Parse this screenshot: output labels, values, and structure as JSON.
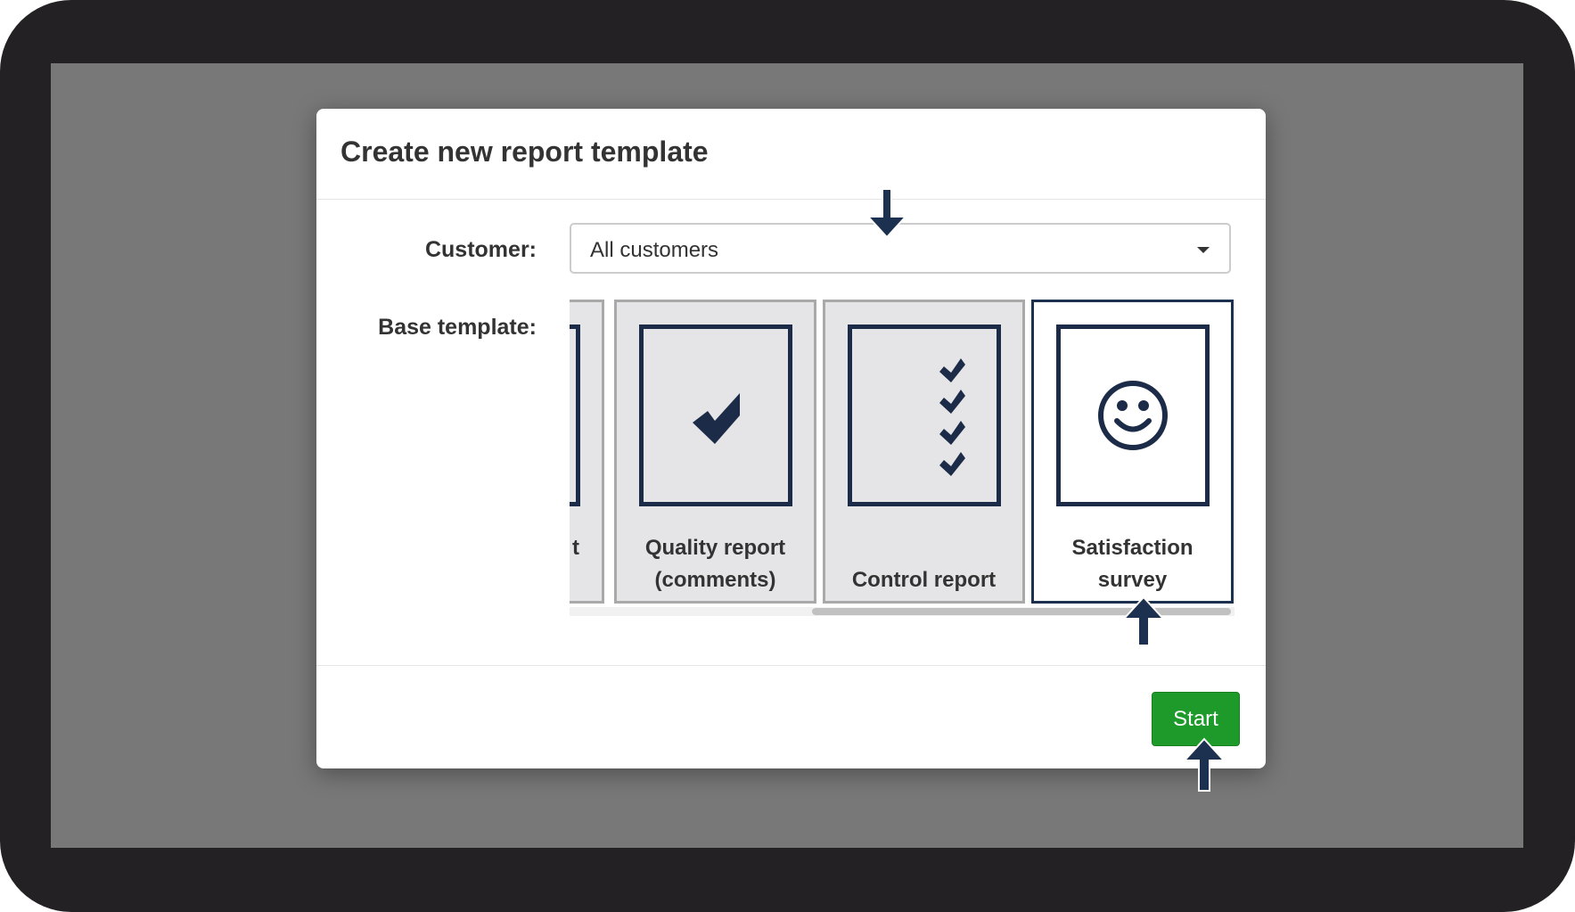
{
  "dialog": {
    "title": "Create new report template"
  },
  "form": {
    "customer_label": "Customer:",
    "customer_value": "All customers",
    "base_template_label": "Base template:"
  },
  "templates": [
    {
      "label_line1": "t",
      "label_line2": "",
      "icon": "partial-card-icon",
      "selected": false
    },
    {
      "label_line1": "Quality report",
      "label_line2": "(comments)",
      "icon": "checkmark-icon",
      "selected": false
    },
    {
      "label_line1": "Control report",
      "label_line2": "",
      "icon": "checklist-icon",
      "selected": false
    },
    {
      "label_line1": "Satisfaction",
      "label_line2": "survey",
      "icon": "smiley-face-icon",
      "selected": true
    }
  ],
  "footer": {
    "start_label": "Start"
  },
  "colors": {
    "frame": "#232123",
    "backdrop": "#787878",
    "icon_navy": "#1c2b47",
    "start_green": "#1e9a2a",
    "callout_arrow": "#1c3050"
  }
}
